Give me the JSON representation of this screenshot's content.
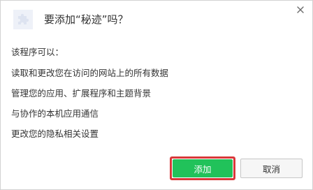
{
  "dialog": {
    "title": "要添加“秘迹”吗？",
    "icon": "puzzle-piece-icon",
    "close_icon": "close-icon"
  },
  "permissions": {
    "heading": "该程序可以：",
    "items": [
      "读取和更改您在访问的网站上的所有数据",
      "管理您的应用、扩展程序和主题背景",
      "与协作的本机应用通信",
      "更改您的隐私相关设置"
    ]
  },
  "buttons": {
    "add_label": "添加",
    "cancel_label": "取消"
  },
  "colors": {
    "add_button": "#21c25a",
    "highlight_outline": "#d9383a",
    "cancel_button": "#f6f6f6"
  }
}
